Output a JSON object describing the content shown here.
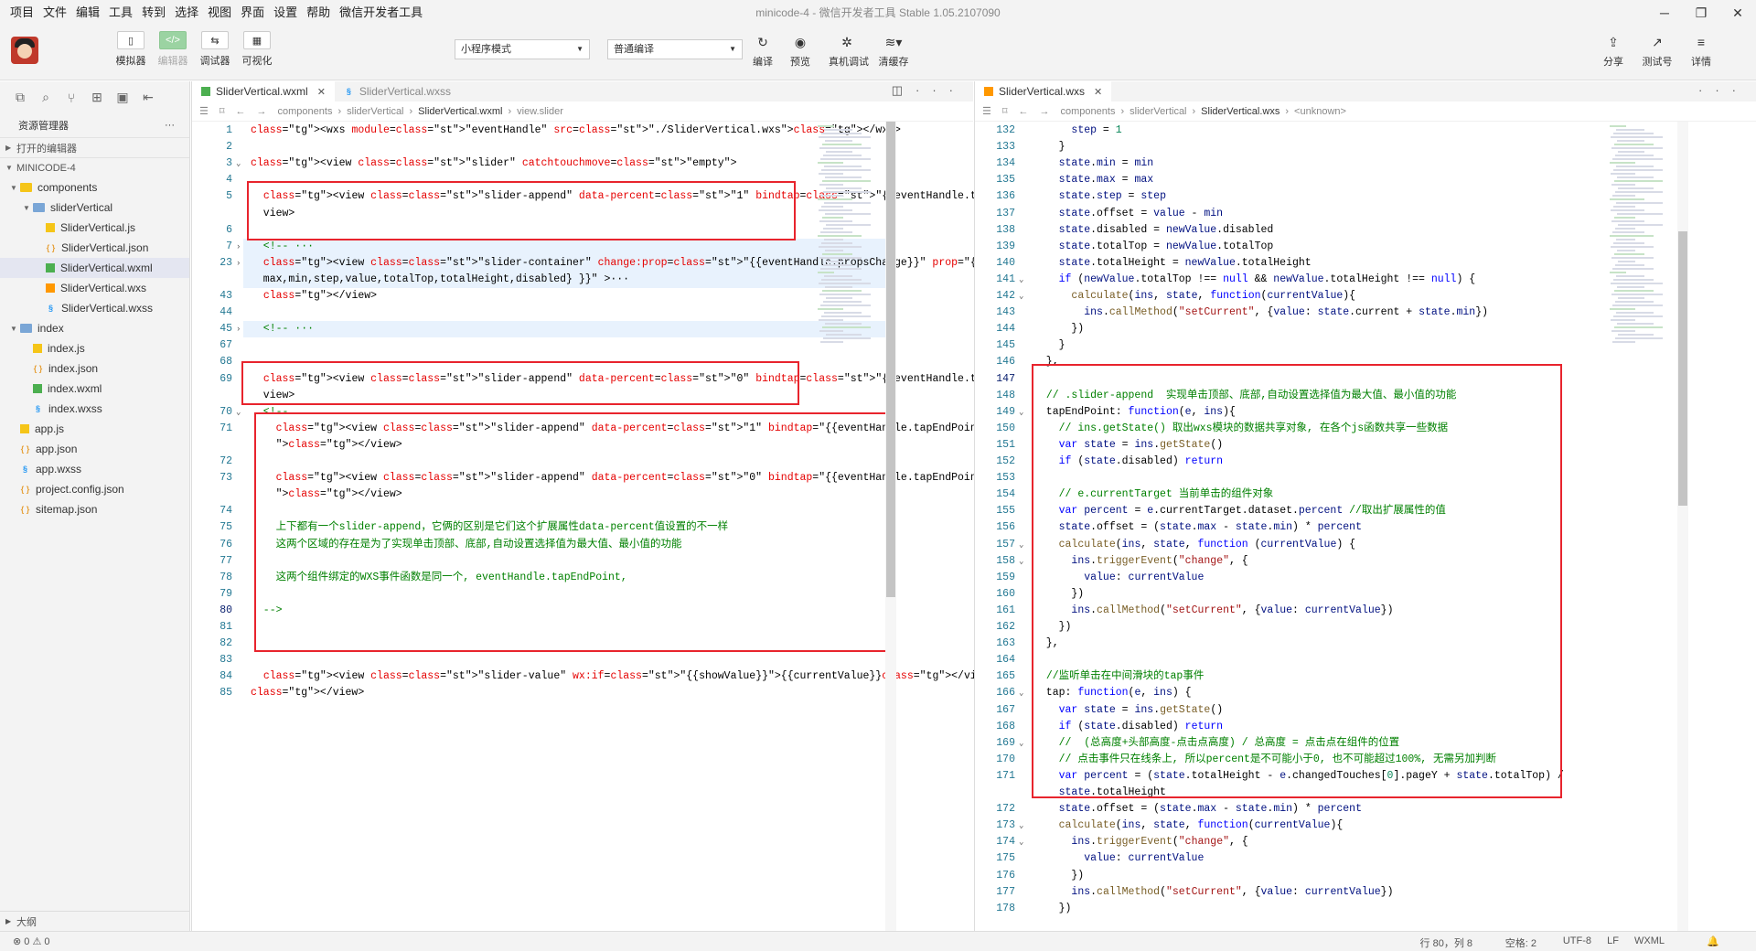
{
  "menu": [
    "项目",
    "文件",
    "编辑",
    "工具",
    "转到",
    "选择",
    "视图",
    "界面",
    "设置",
    "帮助",
    "微信开发者工具"
  ],
  "window_title": "minicode-4 - 微信开发者工具 Stable 1.05.2107090",
  "toolbar": {
    "simulator": "模拟器",
    "editor": "编辑器",
    "debugger": "调试器",
    "visualize": "可视化",
    "mode": "小程序模式",
    "compile_mode": "普通编译",
    "compile": "编译",
    "preview": "预览",
    "remote_debug": "真机调试",
    "clear_cache": "清缓存",
    "share": "分享",
    "test_account": "测试号",
    "details": "详情"
  },
  "sidebar": {
    "title": "资源管理器",
    "open_editors": "打开的编辑器",
    "project": "MINICODE-4",
    "outline": "大纲",
    "tree": [
      {
        "label": "components",
        "depth": 1,
        "type": "folder",
        "open": true
      },
      {
        "label": "sliderVertical",
        "depth": 2,
        "type": "folder",
        "open": true
      },
      {
        "label": "SliderVertical.js",
        "depth": 3,
        "type": "js"
      },
      {
        "label": "SliderVertical.json",
        "depth": 3,
        "type": "json"
      },
      {
        "label": "SliderVertical.wxml",
        "depth": 3,
        "type": "wxml",
        "selected": true
      },
      {
        "label": "SliderVertical.wxs",
        "depth": 3,
        "type": "wxs"
      },
      {
        "label": "SliderVertical.wxss",
        "depth": 3,
        "type": "wxss"
      },
      {
        "label": "index",
        "depth": 1,
        "type": "folder",
        "open": true
      },
      {
        "label": "index.js",
        "depth": 2,
        "type": "js"
      },
      {
        "label": "index.json",
        "depth": 2,
        "type": "json"
      },
      {
        "label": "index.wxml",
        "depth": 2,
        "type": "wxml"
      },
      {
        "label": "index.wxss",
        "depth": 2,
        "type": "wxss"
      },
      {
        "label": "app.js",
        "depth": 1,
        "type": "js"
      },
      {
        "label": "app.json",
        "depth": 1,
        "type": "json"
      },
      {
        "label": "app.wxss",
        "depth": 1,
        "type": "wxss"
      },
      {
        "label": "project.config.json",
        "depth": 1,
        "type": "json"
      },
      {
        "label": "sitemap.json",
        "depth": 1,
        "type": "json"
      }
    ]
  },
  "left_editor": {
    "tabs": [
      "SliderVertical.wxml",
      "SliderVertical.wxss"
    ],
    "breadcrumb": [
      "components",
      "sliderVertical",
      "SliderVertical.wxml",
      "view.slider"
    ],
    "lines": [
      {
        "n": "1",
        "t": "<wxs module=\"eventHandle\" src=\"./SliderVertical.wxs\"></wxs>"
      },
      {
        "n": "2",
        "t": ""
      },
      {
        "n": "3",
        "t": "<view class=\"slider\" catchtouchmove=\"empty\">",
        "f": "v"
      },
      {
        "n": "4",
        "t": ""
      },
      {
        "n": "5",
        "t": "  <view class=\"slider-append\" data-percent=\"1\" bindtap=\"{{eventHandle.tapEndPoint}}\"></"
      },
      {
        "n": "",
        "t": "  view>"
      },
      {
        "n": "6",
        "t": ""
      },
      {
        "n": "7",
        "t": "  <!-- ···",
        "f": ">",
        "h": true
      },
      {
        "n": "23",
        "t": "  <view class=\"slider-container\" change:prop=\"{{eventHandle.propsChange}}\" prop=\"{{",
        "f": ">",
        "h": true
      },
      {
        "n": "",
        "t": "  max,min,step,value,totalTop,totalHeight,disabled} }}\" >···",
        "h": true
      },
      {
        "n": "43",
        "t": "  </view>"
      },
      {
        "n": "44",
        "t": ""
      },
      {
        "n": "45",
        "t": "  <!-- ···",
        "f": ">",
        "h": true
      },
      {
        "n": "67",
        "t": ""
      },
      {
        "n": "68",
        "t": ""
      },
      {
        "n": "69",
        "t": "  <view class=\"slider-append\" data-percent=\"0\" bindtap=\"{{eventHandle.tapEndPoint}}\"></"
      },
      {
        "n": "",
        "t": "  view>"
      },
      {
        "n": "70",
        "t": "  <!--",
        "f": "v"
      },
      {
        "n": "71",
        "t": "    <view class=\"slider-append\" data-percent=\"1\" bindtap=\"{{eventHandle.tapEndPoint}}"
      },
      {
        "n": "",
        "t": "    \"></view>"
      },
      {
        "n": "72",
        "t": ""
      },
      {
        "n": "73",
        "t": "    <view class=\"slider-append\" data-percent=\"0\" bindtap=\"{{eventHandle.tapEndPoint}}"
      },
      {
        "n": "",
        "t": "    \"></view>"
      },
      {
        "n": "74",
        "t": ""
      },
      {
        "n": "75",
        "t": "    上下都有一个slider-append，它俩的区别是它们这个扩展属性data-percent值设置的不一样"
      },
      {
        "n": "76",
        "t": "    这两个区域的存在是为了实现单击顶部、底部,自动设置选择值为最大值、最小值的功能"
      },
      {
        "n": "77",
        "t": ""
      },
      {
        "n": "78",
        "t": "    这两个组件绑定的WXS事件函数是同一个, eventHandle.tapEndPoint,"
      },
      {
        "n": "79",
        "t": ""
      },
      {
        "n": "80",
        "t": "  -->"
      },
      {
        "n": "81",
        "t": ""
      },
      {
        "n": "82",
        "t": ""
      },
      {
        "n": "83",
        "t": ""
      },
      {
        "n": "84",
        "t": "  <view class=\"slider-value\" wx:if=\"{{showValue}}\">{{currentValue}}</view>"
      },
      {
        "n": "85",
        "t": "</view>"
      }
    ]
  },
  "right_editor": {
    "tabs": [
      "SliderVertical.wxs"
    ],
    "breadcrumb": [
      "components",
      "sliderVertical",
      "SliderVertical.wxs",
      "<unknown>"
    ],
    "lines": [
      {
        "n": "132",
        "t": "      step = 1"
      },
      {
        "n": "133",
        "t": "    }"
      },
      {
        "n": "134",
        "t": "    state.min = min"
      },
      {
        "n": "135",
        "t": "    state.max = max"
      },
      {
        "n": "136",
        "t": "    state.step = step"
      },
      {
        "n": "137",
        "t": "    state.offset = value - min"
      },
      {
        "n": "138",
        "t": "    state.disabled = newValue.disabled"
      },
      {
        "n": "139",
        "t": "    state.totalTop = newValue.totalTop"
      },
      {
        "n": "140",
        "t": "    state.totalHeight = newValue.totalHeight"
      },
      {
        "n": "141",
        "t": "    if (newValue.totalTop !== null && newValue.totalHeight !== null) {",
        "f": "v"
      },
      {
        "n": "142",
        "t": "      calculate(ins, state, function(currentValue){",
        "f": "v"
      },
      {
        "n": "143",
        "t": "        ins.callMethod(\"setCurrent\", {value: state.current + state.min})"
      },
      {
        "n": "144",
        "t": "      })"
      },
      {
        "n": "145",
        "t": "    }"
      },
      {
        "n": "146",
        "t": "  },"
      },
      {
        "n": "147",
        "t": ""
      },
      {
        "n": "148",
        "t": "  // .slider-append  实现单击顶部、底部,自动设置选择值为最大值、最小值的功能"
      },
      {
        "n": "149",
        "t": "  tapEndPoint: function(e, ins){",
        "f": "v"
      },
      {
        "n": "150",
        "t": "    // ins.getState() 取出wxs模块的数据共享对象, 在各个js函数共享一些数据"
      },
      {
        "n": "151",
        "t": "    var state = ins.getState()"
      },
      {
        "n": "152",
        "t": "    if (state.disabled) return"
      },
      {
        "n": "153",
        "t": ""
      },
      {
        "n": "154",
        "t": "    // e.currentTarget 当前单击的组件对象"
      },
      {
        "n": "155",
        "t": "    var percent = e.currentTarget.dataset.percent //取出扩展属性的值"
      },
      {
        "n": "156",
        "t": "    state.offset = (state.max - state.min) * percent"
      },
      {
        "n": "157",
        "t": "    calculate(ins, state, function (currentValue) {",
        "f": "v"
      },
      {
        "n": "158",
        "t": "      ins.triggerEvent(\"change\", {",
        "f": "v"
      },
      {
        "n": "159",
        "t": "        value: currentValue"
      },
      {
        "n": "160",
        "t": "      })"
      },
      {
        "n": "161",
        "t": "      ins.callMethod(\"setCurrent\", {value: currentValue})"
      },
      {
        "n": "162",
        "t": "    })"
      },
      {
        "n": "163",
        "t": "  },"
      },
      {
        "n": "164",
        "t": ""
      },
      {
        "n": "165",
        "t": "  //监听单击在中间滑块的tap事件"
      },
      {
        "n": "166",
        "t": "  tap: function(e, ins) {",
        "f": "v"
      },
      {
        "n": "167",
        "t": "    var state = ins.getState()"
      },
      {
        "n": "168",
        "t": "    if (state.disabled) return"
      },
      {
        "n": "169",
        "t": "    //  (总高度+头部高度-点击点高度) / 总高度 = 点击点在组件的位置",
        "f": "v"
      },
      {
        "n": "170",
        "t": "    // 点击事件只在线条上, 所以percent是不可能小于0, 也不可能超过100%, 无需另加判断"
      },
      {
        "n": "171",
        "t": "    var percent = (state.totalHeight - e.changedTouches[0].pageY + state.totalTop) /"
      },
      {
        "n": "",
        "t": "    state.totalHeight"
      },
      {
        "n": "172",
        "t": "    state.offset = (state.max - state.min) * percent"
      },
      {
        "n": "173",
        "t": "    calculate(ins, state, function(currentValue){",
        "f": "v"
      },
      {
        "n": "174",
        "t": "      ins.triggerEvent(\"change\", {",
        "f": "v"
      },
      {
        "n": "175",
        "t": "        value: currentValue"
      },
      {
        "n": "176",
        "t": "      })"
      },
      {
        "n": "177",
        "t": "      ins.callMethod(\"setCurrent\", {value: currentValue})"
      },
      {
        "n": "178",
        "t": "    })"
      }
    ]
  },
  "status": {
    "errors": "0",
    "warnings": "0",
    "position": "行 80，列 8",
    "spaces": "空格: 2",
    "encoding": "UTF-8",
    "eol": "LF",
    "language": "WXML"
  },
  "colors": {
    "highlight_box": "#e8242d",
    "line_number": "#237893",
    "comment": "#008000"
  }
}
